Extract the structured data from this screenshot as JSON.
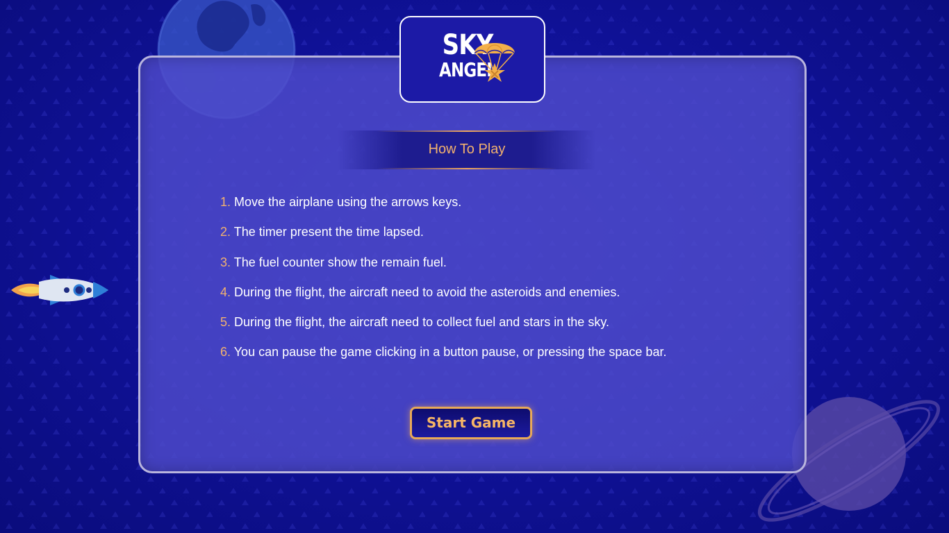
{
  "logo": {
    "line1": "SKY",
    "line2": "ANGEL"
  },
  "header": {
    "title": "How To Play"
  },
  "instructions": [
    {
      "number": "1.",
      "text": "Move the airplane using the arrows keys."
    },
    {
      "number": "2.",
      "text": "The timer present the time lapsed."
    },
    {
      "number": "3.",
      "text": "The fuel counter show the remain fuel."
    },
    {
      "number": "4.",
      "text": "During the flight, the aircraft need to avoid the asteroids and enemies."
    },
    {
      "number": "5.",
      "text": "During the flight, the aircraft need to collect fuel and stars in the sky."
    },
    {
      "number": "6.",
      "text": "You can pause the game clicking in a button pause, or pressing the space bar."
    }
  ],
  "start_button": {
    "label": "Start Game"
  },
  "decorations": [
    "planet-earth",
    "planet-saturn",
    "rocket"
  ],
  "colors": {
    "background": "#0d0f8a",
    "panel": "#4f4ccb",
    "accent": "#f3b26e",
    "text": "#ffffff"
  }
}
